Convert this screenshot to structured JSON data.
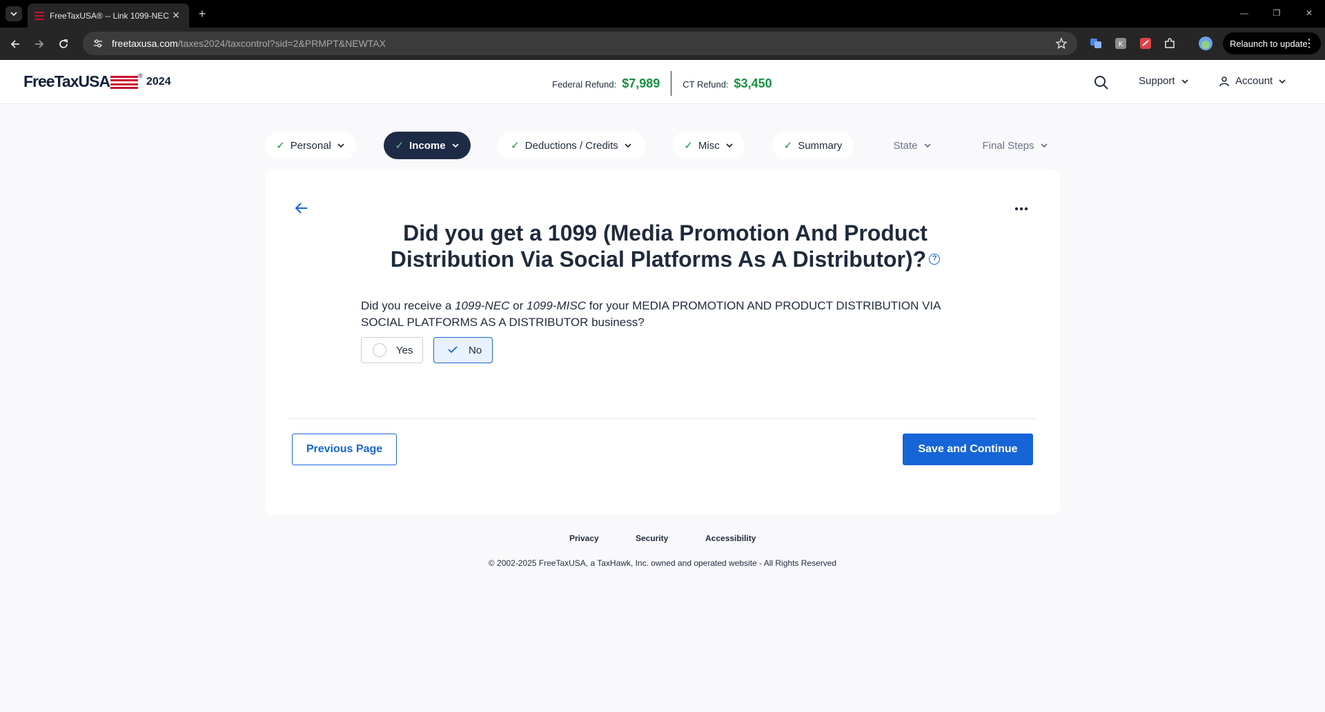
{
  "browser": {
    "tab_title": "FreeTaxUSA® -- Link 1099-NEC",
    "url_host": "freetaxusa.com",
    "url_path": "/taxes2024/taxcontrol?sid=2&PRMPT&NEWTAX",
    "relaunch_label": "Relaunch to update"
  },
  "header": {
    "logo_text": "FreeTaxUSA",
    "logo_mark": "®",
    "tax_year": "2024",
    "federal_refund_label": "Federal Refund:",
    "federal_refund_value": "$7,989",
    "state_refund_label": "CT Refund:",
    "state_refund_value": "$3,450",
    "support_label": "Support",
    "account_label": "Account"
  },
  "steps": [
    {
      "label": "Personal",
      "status": "complete"
    },
    {
      "label": "Income",
      "status": "active"
    },
    {
      "label": "Deductions / Credits",
      "status": "complete"
    },
    {
      "label": "Misc",
      "status": "complete"
    },
    {
      "label": "Summary",
      "status": "complete"
    },
    {
      "label": "State",
      "status": "pending"
    },
    {
      "label": "Final Steps",
      "status": "pending"
    }
  ],
  "main": {
    "question_line1": "Did you get a 1099 (Media Promotion And Product",
    "question_line2": "Distribution Via Social Platforms As A Distributor)?",
    "help_symbol": "?",
    "prompt_a": "Did you receive a ",
    "prompt_form1": "1099-NEC",
    "prompt_b": " or ",
    "prompt_form2": "1099-MISC",
    "prompt_c": " for your MEDIA PROMOTION AND PRODUCT DISTRIBUTION VIA SOCIAL PLATFORMS AS A DISTRIBUTOR business?",
    "option_yes": "Yes",
    "option_no": "No",
    "selected_option": "No",
    "previous_label": "Previous Page",
    "save_label": "Save and Continue"
  },
  "footer": {
    "links": [
      "Privacy",
      "Security",
      "Accessibility"
    ],
    "copyright": "© 2002-2025 FreeTaxUSA, a TaxHawk, Inc. owned and operated website - All Rights Reserved"
  },
  "colors": {
    "accent_blue": "#1565d8",
    "refund_green": "#13933f",
    "active_step": "#1e2b46",
    "brand_red": "#c8102e"
  }
}
